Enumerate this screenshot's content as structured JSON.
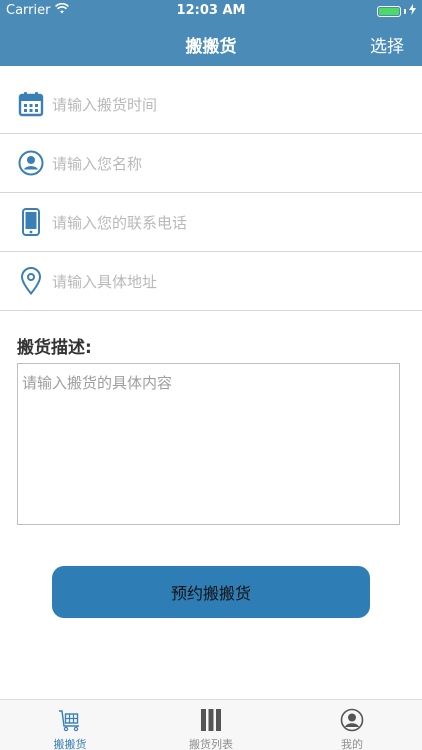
{
  "status_bar": {
    "carrier": "Carrier",
    "time": "12:03 AM"
  },
  "nav": {
    "title": "搬搬货",
    "action": "选择"
  },
  "form": {
    "time_placeholder": "请输入搬货时间",
    "name_placeholder": "请输入您名称",
    "phone_placeholder": "请输入您的联系电话",
    "address_placeholder": "请输入具体地址"
  },
  "description": {
    "label": "搬货描述:",
    "placeholder": "请输入搬货的具体内容"
  },
  "submit": {
    "label": "预约搬搬货"
  },
  "tabs": [
    {
      "label": "搬搬货",
      "icon": "cart-icon",
      "active": true
    },
    {
      "label": "搬货列表",
      "icon": "list-bars-icon",
      "active": false
    },
    {
      "label": "我的",
      "icon": "profile-icon",
      "active": false
    }
  ],
  "colors": {
    "primary": "#4a8bb8",
    "button": "#2f7db5",
    "icon": "#3a7fb5",
    "active_tab": "#3a7fb5",
    "inactive_tab": "#8e8e8e"
  }
}
